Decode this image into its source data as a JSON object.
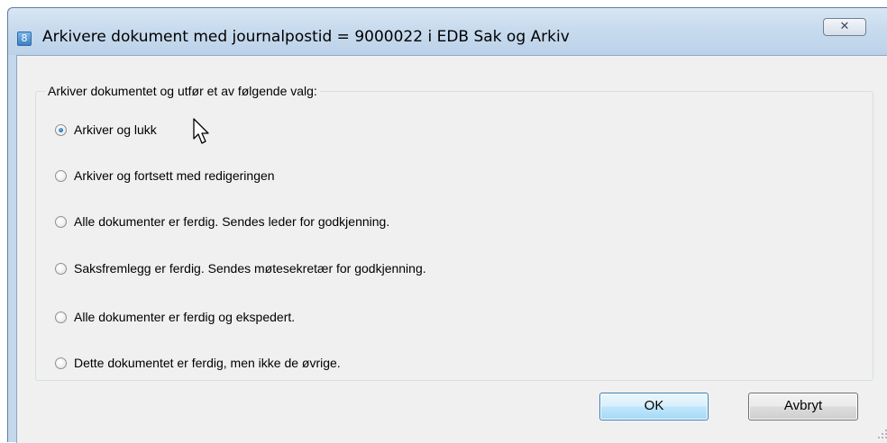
{
  "window": {
    "title": "Arkivere dokument med journalpostid = 9000022 i EDB Sak og Arkiv",
    "app_icon_glyph": "8",
    "close_glyph": "✕"
  },
  "group": {
    "legend": "Arkiver dokumentet og utfør et av følgende valg:"
  },
  "options": [
    {
      "label": "Arkiver og lukk",
      "selected": true
    },
    {
      "label": "Arkiver og fortsett med redigeringen",
      "selected": false
    },
    {
      "label": "Alle dokumenter er ferdig. Sendes leder for godkjenning.",
      "selected": false
    },
    {
      "label": "Saksfremlegg er ferdig. Sendes møtesekretær for godkjenning.",
      "selected": false
    },
    {
      "label": "Alle dokumenter er ferdig og ekspedert.",
      "selected": false
    },
    {
      "label": "Dette dokumentet er ferdig, men ikke de øvrige.",
      "selected": false
    }
  ],
  "buttons": {
    "ok": "OK",
    "cancel": "Avbryt"
  },
  "icons": {
    "app": "edb-sak-arkiv-icon",
    "close": "close-icon",
    "cursor": "mouse-pointer-icon",
    "grip": "resize-grip-icon"
  }
}
